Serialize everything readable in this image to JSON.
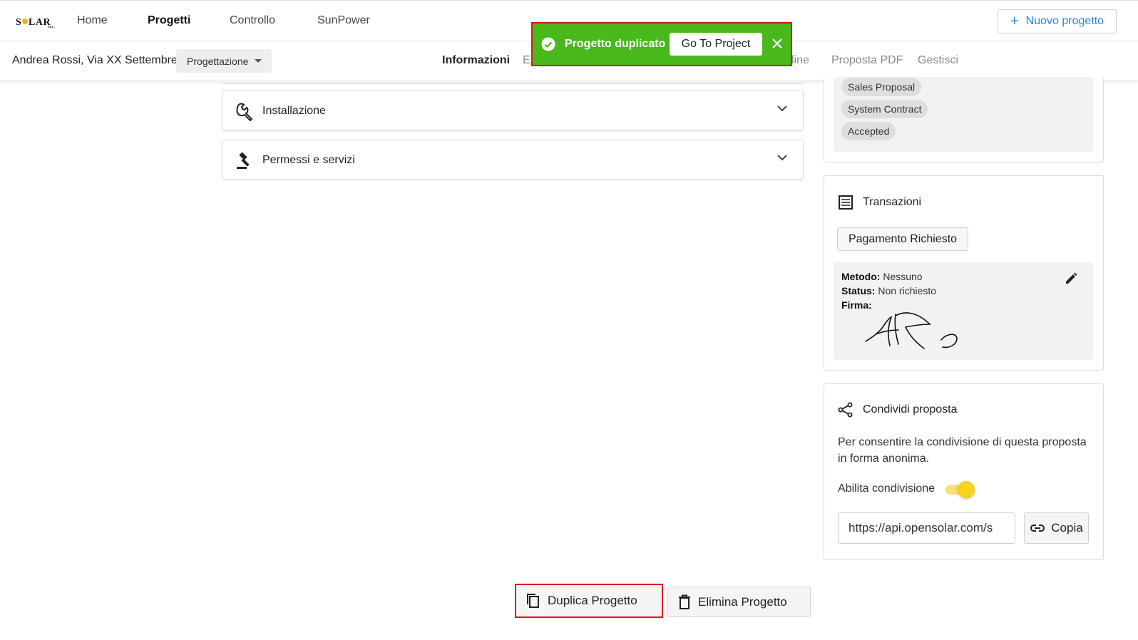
{
  "brand": {
    "logo_text": "SOLAR",
    "logo_sub": "Inc."
  },
  "nav": {
    "items": [
      {
        "label": "Home"
      },
      {
        "label": "Progetti"
      },
      {
        "label": "Controllo"
      },
      {
        "label": "SunPower"
      }
    ],
    "new_project_label": "Nuovo progetto",
    "accent": "#1e88e5"
  },
  "project": {
    "name": "Andrea Rossi, Via XX Settembre",
    "stage": "Progettazione"
  },
  "tabs": [
    {
      "label": "Informazioni"
    },
    {
      "label": "E"
    },
    {
      "label": "line"
    },
    {
      "label": "Proposta PDF"
    },
    {
      "label": "Gestisci"
    }
  ],
  "toast": {
    "message": "Progetto duplicato",
    "action_label": "Go To Project",
    "color": "#48b81a"
  },
  "sections": [
    {
      "label": "Installazione",
      "icon": "wrench-icon"
    },
    {
      "label": "Permessi e servizi",
      "icon": "gavel-icon"
    }
  ],
  "status_chips": [
    "Sales Proposal",
    "System Contract",
    "Accepted"
  ],
  "transactions": {
    "title": "Transazioni",
    "payment_button": "Pagamento Richiesto",
    "method_label": "Metodo:",
    "method_value": "Nessuno",
    "status_label": "Status:",
    "status_value": "Non richiesto",
    "signature_label": "Firma:"
  },
  "share": {
    "title": "Condividi proposta",
    "description": "Per consentire la condivisione di questa proposta in forma anonima.",
    "toggle_label": "Abilita condivisione",
    "toggle_on": true,
    "url": "https://api.opensolar.com/s",
    "copy_label": "Copia",
    "toggle_color": "#f7d31a"
  },
  "actions": {
    "duplicate_label": "Duplica Progetto",
    "delete_label": "Elimina Progetto"
  }
}
